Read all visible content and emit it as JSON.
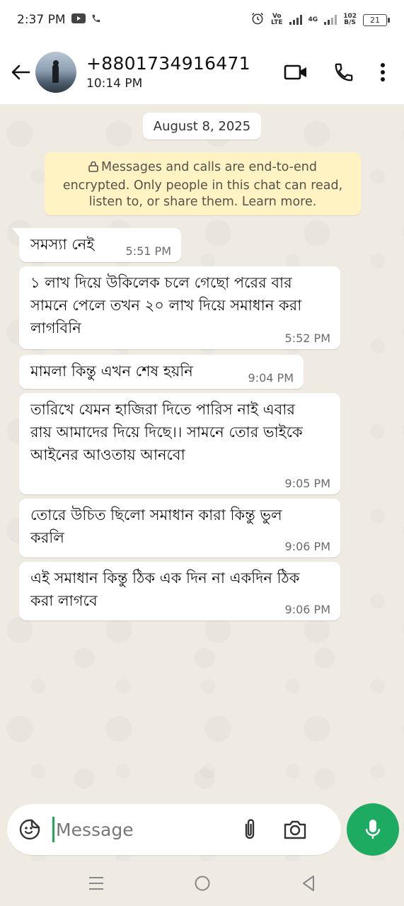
{
  "status_bar": {
    "time": "2:37 PM",
    "volte_top": "Vo",
    "volte_bottom": "LTE",
    "network_top": "4G",
    "speed_top": "102",
    "speed_bottom": "B/S",
    "battery": "21"
  },
  "header": {
    "contact_name": "+8801734916471",
    "contact_status": "10:14 PM"
  },
  "chat": {
    "date": "August 8, 2025",
    "encryption_notice": "Messages and calls are end-to-end encrypted. Only people in this chat can read, listen to, or share them. Learn more.",
    "messages": [
      {
        "text": "সমস্যা নেই",
        "time": "5:51 PM"
      },
      {
        "text": "১ লাখ দিয়ে উকিলেক চলে গেছো পরের বার সামনে পেলে তখন ২০ লাখ দিয়ে সমাধান করা লাগবিনি",
        "time": "5:52 PM"
      },
      {
        "text": "মামলা কিন্তু এখন শেষ হয়নি",
        "time": "9:04 PM"
      },
      {
        "text": "তারিখে যেমন হাজিরা দিতে পারিস নাই এবার রায় আমাদের দিয়ে দিছে।। সামনে তোর ভাইকে আইনের আওতায় আনবো",
        "time": "9:05 PM"
      },
      {
        "text": "তোরে উচিত ছিলো সমাধান কারা কিন্তু ভুল করলি",
        "time": "9:06 PM"
      },
      {
        "text": "এই সমাধান কিন্তু ঠিক এক দিন না একদিন ঠিক করা লাগবে",
        "time": "9:06 PM"
      }
    ]
  },
  "composer": {
    "placeholder": "Message"
  },
  "colors": {
    "accent": "#1daa61",
    "chat_background": "#efeae2",
    "encryption_note": "#fff3c4"
  }
}
